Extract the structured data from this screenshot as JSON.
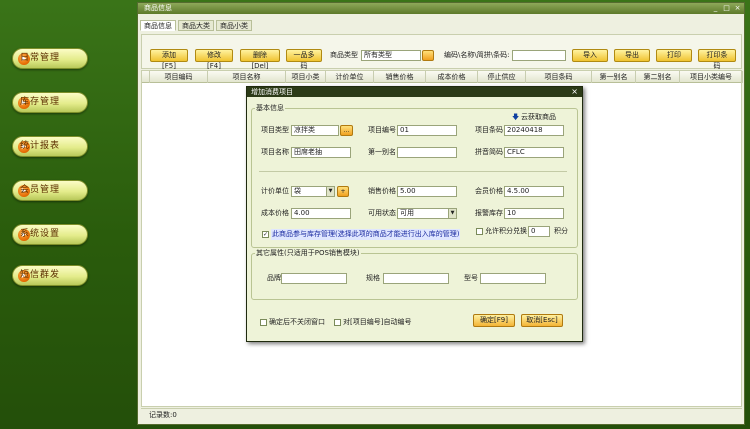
{
  "sidebar": {
    "items": [
      {
        "label": "日常管理"
      },
      {
        "label": "库存管理"
      },
      {
        "label": "统计报表"
      },
      {
        "label": "会员管理"
      },
      {
        "label": "系统设置"
      },
      {
        "label": "短信群发"
      }
    ]
  },
  "window": {
    "title": "商品信息",
    "controls": [
      "_",
      "□",
      "×"
    ]
  },
  "tabs": [
    "商品信息",
    "商品大类",
    "商品小类"
  ],
  "toolbar": {
    "add": "添加 [F5]",
    "edit": "修改 [F4]",
    "delete": "删除 [Del]",
    "multi": "一品多码",
    "type_label": "商品类型",
    "type_value": "所有类型",
    "search_label": "编码\\名称\\简拼\\条码:",
    "search_value": "",
    "import": "导入",
    "export": "导出",
    "print": "打印",
    "print_barcode": "打印条码"
  },
  "grid": {
    "columns": [
      "项目编码",
      "项目名称",
      "项目小类",
      "计价单位",
      "销售价格",
      "成本价格",
      "停止供应",
      "项目条码",
      "第一别名",
      "第二别名",
      "项目小类编号"
    ]
  },
  "status": {
    "record_count": "记录数:0"
  },
  "dialog": {
    "title": "增加消费项目",
    "close": "×",
    "basic_group": "基本信息",
    "cloud_fetch": "云获取商品",
    "fields": {
      "item_type_label": "项目类型",
      "item_type_value": "凉拌类",
      "item_type_btn": "...",
      "item_code_label": "项目编号",
      "item_code_value": "01",
      "barcode_label": "项目条码",
      "barcode_value": "20240418",
      "name_label": "项目名称",
      "name_value": "田席老抽",
      "alias1_label": "第一别名",
      "alias1_value": "",
      "pinyin_label": "拼音简码",
      "pinyin_value": "CFLC",
      "unit_label": "计价单位",
      "unit_value": "袋",
      "unit_btn": "+",
      "sale_price_label": "销售价格",
      "sale_price_value": "5.00",
      "member_price_label": "会员价格",
      "member_price_value": "4.5.00",
      "cost_label": "成本价格",
      "cost_value": "4.00",
      "available_label": "可用状态",
      "available_value": "可用",
      "alert_label": "报警库存",
      "alert_value": "10",
      "inventory_check": "此商品参与库存管理(选择此项的商品才能进行出入库的管理)",
      "points_check": "允许积分兑换",
      "points_value": "0",
      "points_unit": "积分"
    },
    "other_group": "其它属性(只适用于POS销售模块)",
    "other": {
      "brand_label": "品牌",
      "spec_label": "规格",
      "model_label": "型号"
    },
    "keep_open": "确定后不关闭窗口",
    "auto_code": "对[项目编号]自动编号",
    "ok": "确定[F9]",
    "cancel": "取消[Esc]"
  }
}
